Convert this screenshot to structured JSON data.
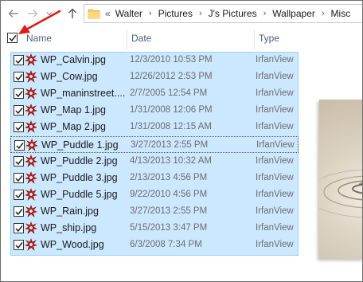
{
  "address_bar": {
    "overflow": "«",
    "crumbs": [
      "Walter",
      "Pictures",
      "J's Pictures",
      "Wallpaper",
      "Misc"
    ]
  },
  "columns": {
    "name": "Name",
    "date": "Date",
    "type": "Type"
  },
  "files": [
    {
      "name": "WP_Calvin.jpg",
      "date": "12/3/2010 10:53 PM",
      "type": "IrfanView"
    },
    {
      "name": "WP_Cow.jpg",
      "date": "12/26/2012 2:53 PM",
      "type": "IrfanView"
    },
    {
      "name": "WP_maninstreet....",
      "date": "2/7/2005 12:54 PM",
      "type": "IrfanView"
    },
    {
      "name": "WP_Map 1.jpg",
      "date": "1/31/2008 12:06 PM",
      "type": "IrfanView"
    },
    {
      "name": "WP_Map 2.jpg",
      "date": "1/31/2008 12:15 AM",
      "type": "IrfanView"
    },
    {
      "name": "WP_Puddle 1.jpg",
      "date": "3/27/2013 2:55 PM",
      "type": "IrfanView"
    },
    {
      "name": "WP_Puddle 2.jpg",
      "date": "4/13/2013 10:32 AM",
      "type": "IrfanView"
    },
    {
      "name": "WP_Puddle 3.jpg",
      "date": "2/13/2013 4:56 PM",
      "type": "IrfanView"
    },
    {
      "name": "WP_Puddle 5.jpg",
      "date": "9/22/2010 4:56 PM",
      "type": "IrfanView"
    },
    {
      "name": "WP_Rain.jpg",
      "date": "3/27/2013 2:55 PM",
      "type": "IrfanView"
    },
    {
      "name": "WP_ship.jpg",
      "date": "5/15/2013 3:47 PM",
      "type": "IrfanView"
    },
    {
      "name": "WP_Wood.jpg",
      "date": "6/3/2008 7:34 PM",
      "type": "IrfanView"
    }
  ],
  "icons": {
    "back": "back-arrow-icon",
    "forward": "forward-arrow-icon",
    "recent": "chevron-down-icon",
    "up": "up-arrow-icon",
    "folder": "folder-icon",
    "file": "irfanview-file-icon",
    "check": "check-icon"
  },
  "colors": {
    "selection": "#cce8ff",
    "selection_border": "#99d1ff",
    "annotation_arrow": "#e11a1a",
    "header_text": "#4c607a"
  }
}
